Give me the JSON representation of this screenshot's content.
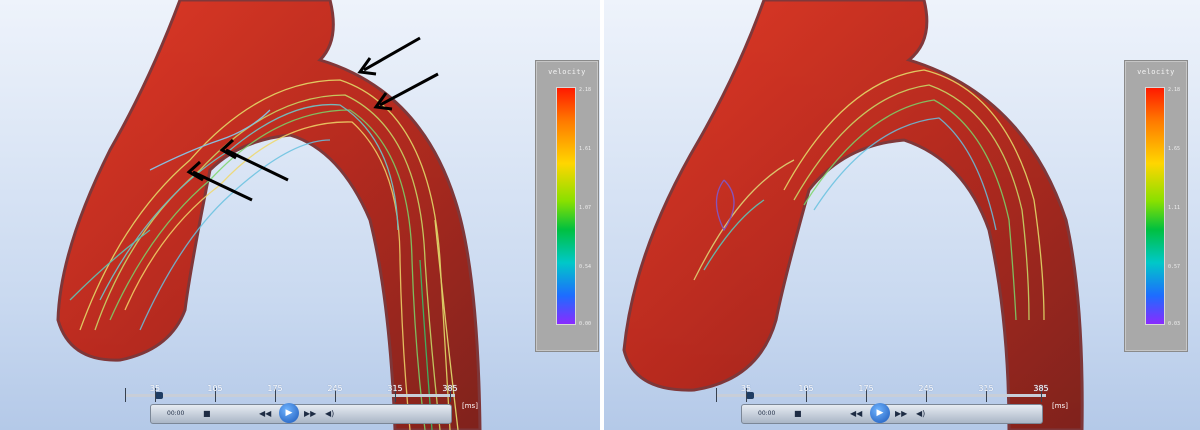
{
  "panels": [
    {
      "legend": {
        "title": "velocity",
        "ticks": [
          "2.18",
          "1.61",
          "1.07",
          "0.54",
          "0.00"
        ]
      },
      "timeline": {
        "labels": [
          "35",
          "105",
          "175",
          "245",
          "315",
          "385"
        ],
        "unit": "[ms]",
        "time": "00:00"
      },
      "arrows_count": 4
    },
    {
      "legend": {
        "title": "velocity",
        "ticks": [
          "2.18",
          "1.65",
          "1.11",
          "0.57",
          "0.03"
        ]
      },
      "timeline": {
        "labels": [
          "35",
          "105",
          "175",
          "245",
          "315",
          "385"
        ],
        "unit": "[ms]",
        "time": "00:00"
      },
      "arrows_count": 0
    }
  ],
  "controls": {
    "icons": [
      "stop-icon",
      "rewind-icon",
      "play-icon",
      "forward-icon",
      "volume-icon"
    ]
  },
  "colors": {
    "vessel": "#b52114",
    "vessel_edge": "#7b2f30",
    "background_top": "#eef3fb",
    "background_bottom": "#b4c9e8"
  }
}
